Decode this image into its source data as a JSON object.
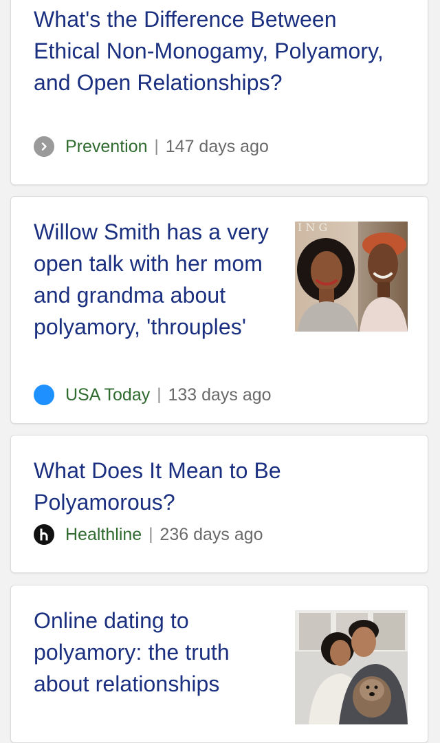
{
  "articles": [
    {
      "headline": "What's the Difference Between Ethical Non-Monogamy, Polyamory, and Open Relationships?",
      "source": "Prevention",
      "separator": "|",
      "age": "147 days ago",
      "icon": "chevron-right-icon",
      "icon_color": "#9a9a9a"
    },
    {
      "headline": "Willow Smith has a very open talk with her mom and grandma about polyamory, 'throuples'",
      "source": "USA Today",
      "separator": "|",
      "age": "133 days ago",
      "icon": "usa-today-dot-icon",
      "icon_color": "#1e90ff",
      "thumbnail": "photo-two-women"
    },
    {
      "headline": "What Does It Mean to Be Polyamorous?",
      "source": "Healthline",
      "separator": "|",
      "age": "236 days ago",
      "icon": "healthline-logo-icon",
      "icon_color": "#111111"
    },
    {
      "headline": "Online dating to polyamory: the truth about relationships",
      "thumbnail": "photo-couple-with-dog"
    }
  ],
  "colors": {
    "headline": "#1a2f7f",
    "source": "#2f6b2f",
    "meta": "#6a6a6a",
    "background": "#f2f2f2"
  }
}
